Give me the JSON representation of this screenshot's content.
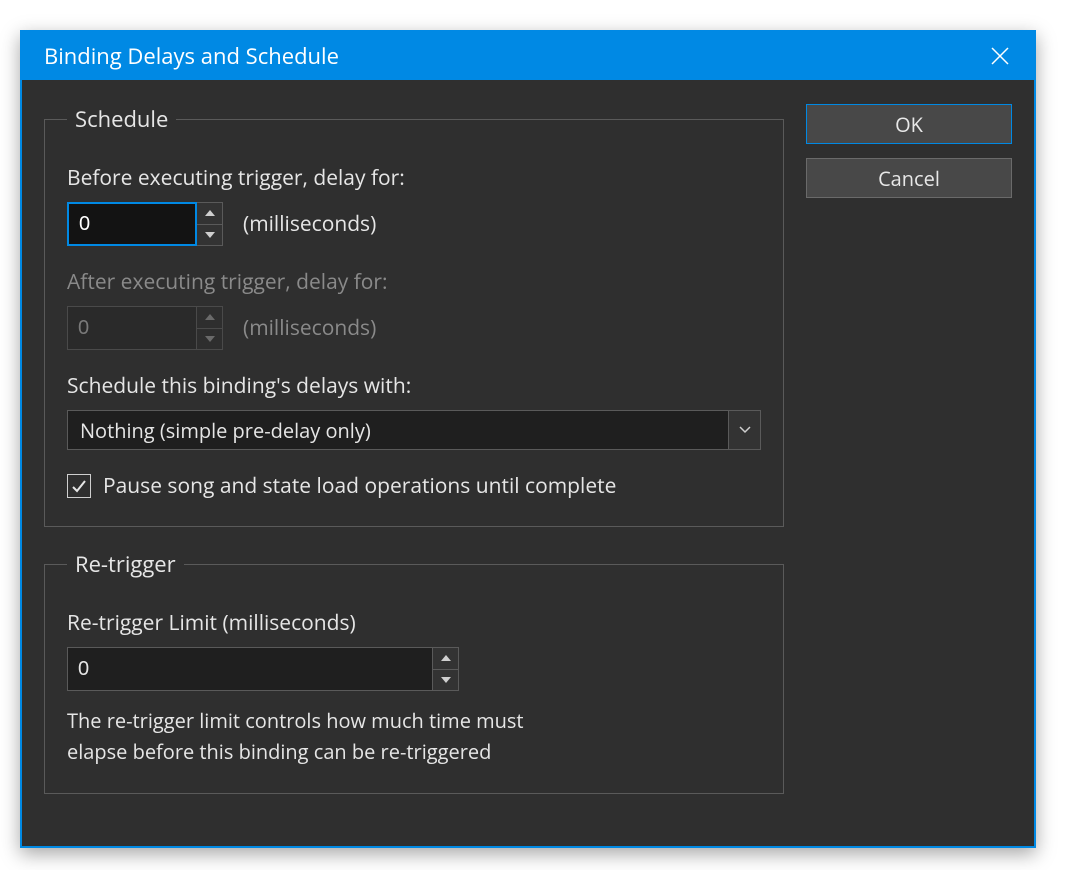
{
  "window": {
    "title": "Binding Delays and Schedule"
  },
  "buttons": {
    "ok": "OK",
    "cancel": "Cancel"
  },
  "schedule": {
    "legend": "Schedule",
    "before_label": "Before executing trigger, delay for:",
    "before_value": "0",
    "before_unit": "(milliseconds)",
    "after_label": "After executing trigger, delay for:",
    "after_value": "0",
    "after_unit": "(milliseconds)",
    "with_label": "Schedule this binding's delays with:",
    "with_value": "Nothing (simple pre-delay only)",
    "pause_label": "Pause song and state load operations until complete",
    "pause_checked": true
  },
  "retrigger": {
    "legend": "Re-trigger",
    "limit_label": "Re-trigger Limit (milliseconds)",
    "limit_value": "0",
    "help_line1": "The re-trigger limit controls how much time must",
    "help_line2": "elapse before this binding can be re-triggered"
  }
}
